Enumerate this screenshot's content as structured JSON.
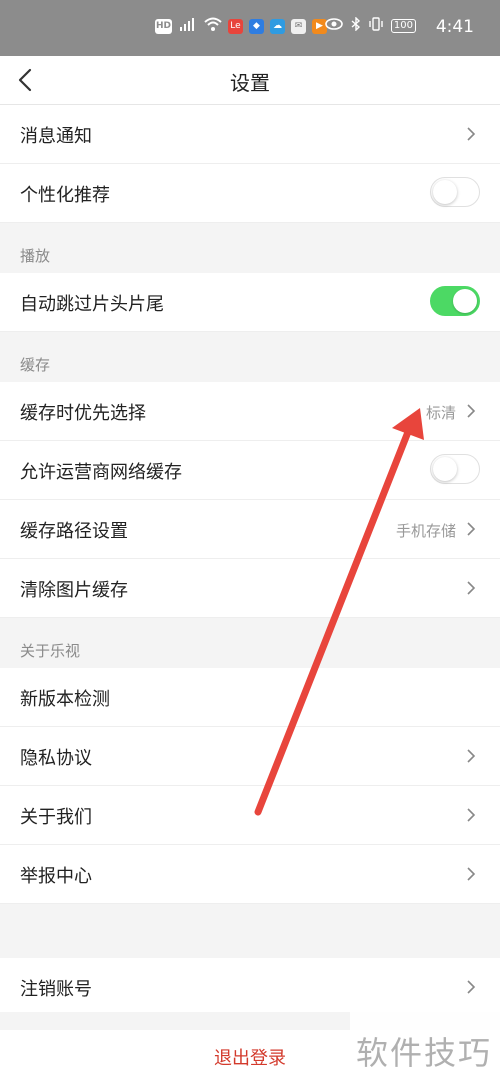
{
  "status_bar": {
    "time": "4:41",
    "left_icons": [
      "hd-icon",
      "4g-signal-icon",
      "wifi-icon",
      "letv-app-icon",
      "shield-app-icon",
      "cloud-app-icon",
      "mail-app-icon",
      "video-app-icon"
    ],
    "hd_label": "HD",
    "battery": "100"
  },
  "header": {
    "title": "设置"
  },
  "sections": {
    "top": {
      "items": [
        {
          "label": "消息通知"
        },
        {
          "label": "个性化推荐"
        }
      ]
    },
    "playback": {
      "header": "播放",
      "items": [
        {
          "label": "自动跳过片头片尾"
        }
      ]
    },
    "cache": {
      "header": "缓存",
      "items": [
        {
          "label": "缓存时优先选择",
          "value": "标清"
        },
        {
          "label": "允许运营商网络缓存"
        },
        {
          "label": "缓存路径设置",
          "value": "手机存储"
        },
        {
          "label": "清除图片缓存"
        }
      ]
    },
    "about": {
      "header": "关于乐视",
      "items": [
        {
          "label": "新版本检测"
        },
        {
          "label": "隐私协议"
        },
        {
          "label": "关于我们"
        },
        {
          "label": "举报中心"
        }
      ]
    },
    "account": {
      "items": [
        {
          "label": "注销账号"
        }
      ]
    }
  },
  "toggles": {
    "personalized_recommend": false,
    "auto_skip_intro": true,
    "carrier_network_cache": false
  },
  "logout": {
    "label": "退出登录"
  },
  "watermark": {
    "text": "软件技巧"
  },
  "colors": {
    "toggle_on": "#4cd964",
    "logout_text": "#d33a2c",
    "annotation_arrow": "#e8453c",
    "status_bar_bg": "#8c8c8c"
  }
}
